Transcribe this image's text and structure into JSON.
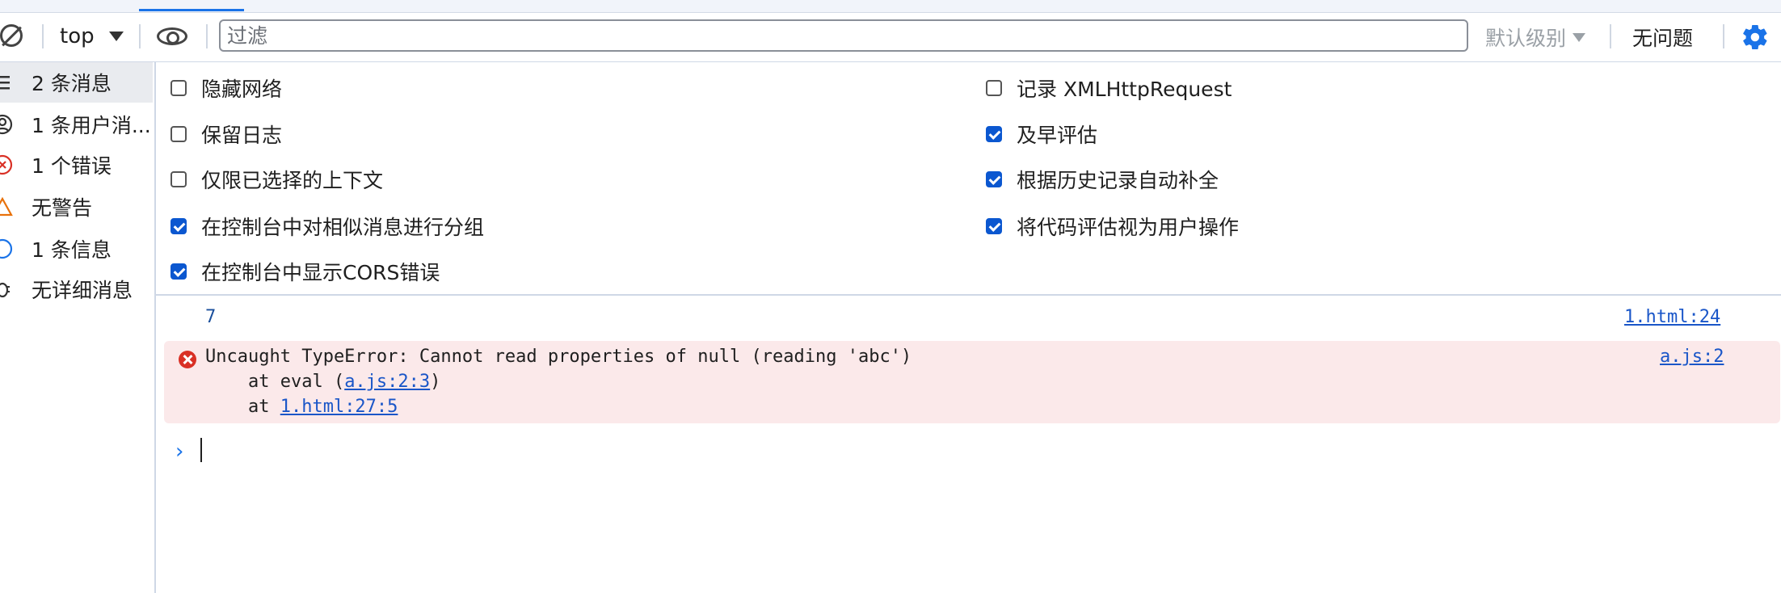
{
  "toolbar": {
    "context": "top",
    "filter_placeholder": "过滤",
    "levels_label": "默认级别",
    "issues_label": "无问题"
  },
  "sidebar": {
    "items": [
      {
        "label": "2 条消息",
        "icon": "list-icon",
        "selected": true
      },
      {
        "label": "1 条用户消...",
        "icon": "user-icon",
        "selected": false
      },
      {
        "label": "1 个错误",
        "icon": "error-icon",
        "selected": false
      },
      {
        "label": "无警告",
        "icon": "warning-icon",
        "selected": false
      },
      {
        "label": "1 条信息",
        "icon": "info-icon",
        "selected": false
      },
      {
        "label": "无详细消息",
        "icon": "bug-icon",
        "selected": false
      }
    ]
  },
  "settings": {
    "left": [
      {
        "label": "隐藏网络",
        "checked": false
      },
      {
        "label": "保留日志",
        "checked": false
      },
      {
        "label": "仅限已选择的上下文",
        "checked": false
      },
      {
        "label": "在控制台中对相似消息进行分组",
        "checked": true
      },
      {
        "label": "在控制台中显示CORS错误",
        "checked": true
      }
    ],
    "right": [
      {
        "label": "记录 XMLHttpRequest",
        "checked": false
      },
      {
        "label": "及早评估",
        "checked": true
      },
      {
        "label": "根据历史记录自动补全",
        "checked": true
      },
      {
        "label": "将代码评估视为用户操作",
        "checked": true
      }
    ]
  },
  "console": {
    "log_value": "7",
    "log_source": "1.html:24",
    "error": {
      "message": "Uncaught TypeError: Cannot read properties of null (reading 'abc')",
      "source": "a.js:2",
      "stack1_prefix": "    at eval (",
      "stack1_link": "a.js:2:3",
      "stack1_suffix": ")",
      "stack2_prefix": "    at ",
      "stack2_link": "1.html:27:5"
    },
    "prompt_symbol": "›"
  },
  "colors": {
    "accent": "#1a73e8",
    "checkbox": "#0b57d0",
    "error_bg": "#fbe9ea",
    "error_icon": "#d93025",
    "link": "#1a56c8"
  }
}
